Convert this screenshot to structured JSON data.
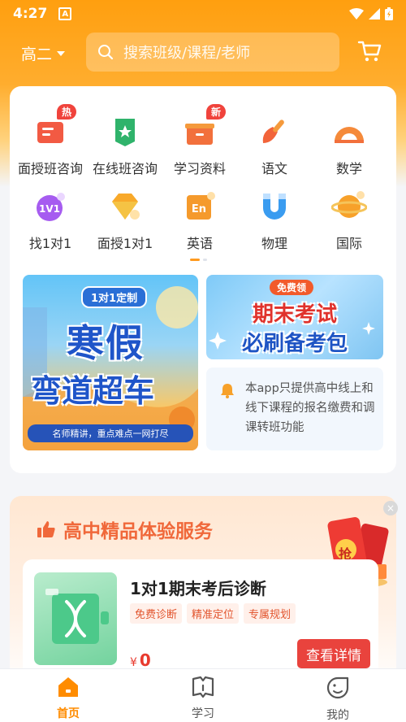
{
  "status_bar": {
    "time": "4:27",
    "app_indicator": "A"
  },
  "header": {
    "grade_label": "高二",
    "search_placeholder": "搜索班级/课程/老师",
    "cart_icon": "cart-icon"
  },
  "categories": [
    {
      "label": "面授班咨询",
      "icon": "offline-class-consult-icon",
      "badge": "热"
    },
    {
      "label": "在线班咨询",
      "icon": "online-class-consult-icon",
      "badge": ""
    },
    {
      "label": "学习资料",
      "icon": "study-materials-icon",
      "badge": "新"
    },
    {
      "label": "语文",
      "icon": "chinese-brush-icon",
      "badge": ""
    },
    {
      "label": "数学",
      "icon": "math-protractor-icon",
      "badge": ""
    },
    {
      "label": "找1对1",
      "icon": "one-on-one-icon",
      "badge": ""
    },
    {
      "label": "面授1对1",
      "icon": "offline-one-on-one-icon",
      "badge": ""
    },
    {
      "label": "英语",
      "icon": "english-icon",
      "badge": ""
    },
    {
      "label": "物理",
      "icon": "physics-magnet-icon",
      "badge": ""
    },
    {
      "label": "国际",
      "icon": "international-planet-icon",
      "badge": ""
    }
  ],
  "banner_left": {
    "tag": "1对1定制",
    "line1": "寒假",
    "line2": "弯道超车",
    "sub": "名师精讲，重点难点一网打尽"
  },
  "banner_right": {
    "tag": "免费领",
    "line1": "期末考试",
    "line2": "必刷备考包"
  },
  "notice": {
    "text": "本app只提供高中线上和线下课程的报名缴费和调课转班功能"
  },
  "experience": {
    "title": "高中精品体验服务",
    "close": "×",
    "redpack_char": "抢",
    "product": {
      "title": "1对1期末考后诊断",
      "tags": [
        "免费诊断",
        "精准定位",
        "专属规划"
      ],
      "currency": "¥",
      "price": "0",
      "button": "查看详情"
    }
  },
  "tabbar": {
    "tabs": [
      {
        "label": "首页",
        "icon": "home-icon",
        "active": true
      },
      {
        "label": "学习",
        "icon": "book-icon",
        "active": false
      },
      {
        "label": "我的",
        "icon": "profile-icon",
        "active": false
      }
    ]
  },
  "colors": {
    "accent": "#ff9f0f",
    "primary_red": "#e9433d",
    "tab_active": "#ff8c00"
  }
}
